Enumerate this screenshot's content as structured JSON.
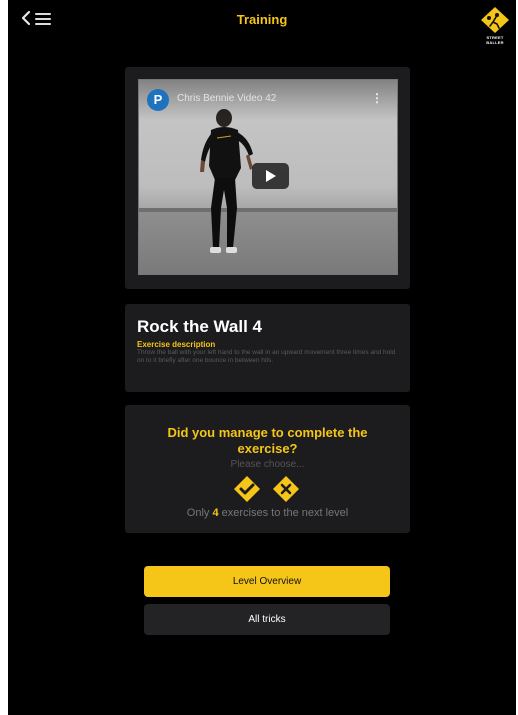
{
  "header": {
    "title": "Training",
    "back_icon": "chevron-left-icon",
    "menu_icon": "hamburger-menu-icon",
    "logo_caption": "STREET BALLER"
  },
  "video": {
    "channel_initial": "P",
    "title": "Chris Bennie Video 42",
    "more_icon": "more-vertical-icon",
    "play_icon": "play-icon"
  },
  "exercise": {
    "title": "Rock the Wall 4",
    "description_label": "Exercise description",
    "description_text": "Throw the ball with your left hand to the wall in an upward movement three times and hold on to it briefly after one bounce in between hits."
  },
  "feedback": {
    "question": "Did you manage to complete the exercise?",
    "prompt": "Please choose...",
    "yes_icon": "check-icon",
    "no_icon": "close-icon",
    "remaining_prefix": "Only ",
    "remaining_count": "4",
    "remaining_suffix": " exercises to the next level"
  },
  "actions": {
    "level_overview": "Level Overview",
    "all_tricks": "All tricks"
  },
  "colors": {
    "accent": "#f5c518",
    "background": "#000000",
    "card": "#1c1c1e"
  }
}
